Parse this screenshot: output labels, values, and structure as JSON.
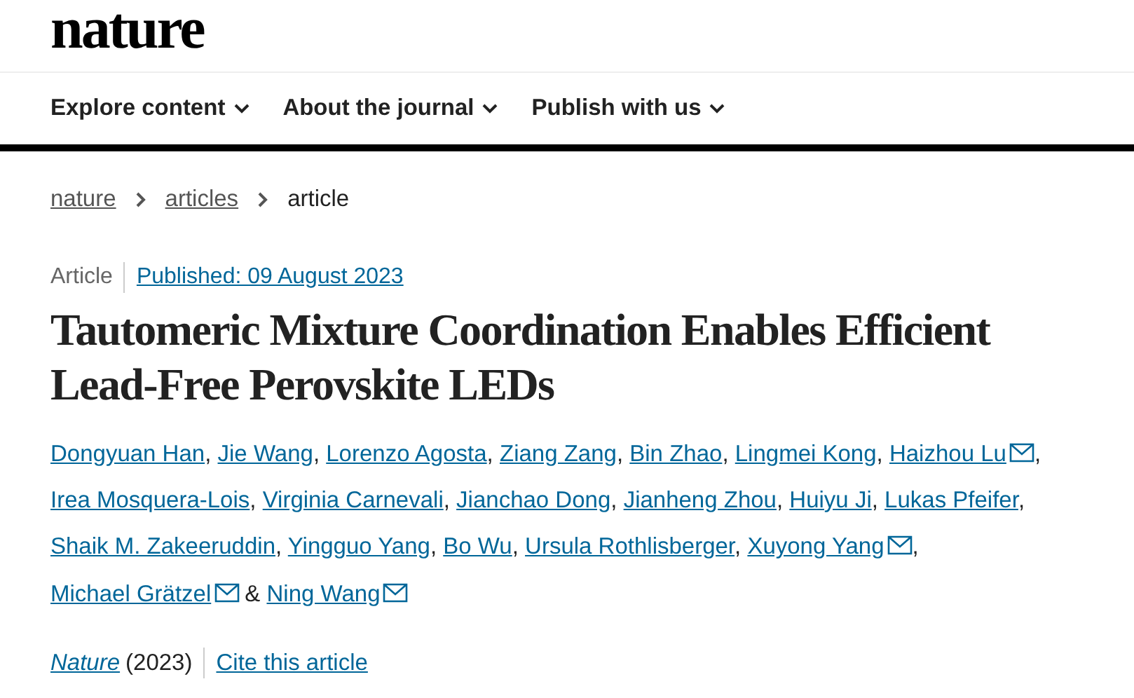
{
  "logo": "nature",
  "nav": [
    {
      "label": "Explore content"
    },
    {
      "label": "About the journal"
    },
    {
      "label": "Publish with us"
    }
  ],
  "breadcrumb": [
    {
      "label": "nature",
      "link": true
    },
    {
      "label": "articles",
      "link": true
    },
    {
      "label": "article",
      "link": false
    }
  ],
  "article_type": "Article",
  "published": "Published: 09 August 2023",
  "title": "Tautomeric Mixture Coordination Enables Efficient Lead-Free Perovskite LEDs",
  "authors": [
    {
      "name": "Dongyuan Han",
      "contact": false,
      "after": ","
    },
    {
      "name": "Jie Wang",
      "contact": false,
      "after": ","
    },
    {
      "name": "Lorenzo Agosta",
      "contact": false,
      "after": ","
    },
    {
      "name": "Ziang Zang",
      "contact": false,
      "after": ","
    },
    {
      "name": "Bin Zhao",
      "contact": false,
      "after": ","
    },
    {
      "name": "Lingmei Kong",
      "contact": false,
      "after": ","
    },
    {
      "name": "Haizhou Lu",
      "contact": true,
      "after": ","
    },
    {
      "name": "Irea Mosquera-Lois",
      "contact": false,
      "after": ","
    },
    {
      "name": "Virginia Carnevali",
      "contact": false,
      "after": ","
    },
    {
      "name": "Jianchao Dong",
      "contact": false,
      "after": ","
    },
    {
      "name": "Jianheng Zhou",
      "contact": false,
      "after": ","
    },
    {
      "name": "Huiyu Ji",
      "contact": false,
      "after": ","
    },
    {
      "name": "Lukas Pfeifer",
      "contact": false,
      "after": ","
    },
    {
      "name": "Shaik M. Zakeeruddin",
      "contact": false,
      "after": ","
    },
    {
      "name": "Yingguo Yang",
      "contact": false,
      "after": ","
    },
    {
      "name": "Bo Wu",
      "contact": false,
      "after": ","
    },
    {
      "name": "Ursula Rothlisberger",
      "contact": false,
      "after": ","
    },
    {
      "name": "Xuyong Yang",
      "contact": true,
      "after": ","
    },
    {
      "name": "Michael Grätzel",
      "contact": true,
      "after": "&"
    },
    {
      "name": "Ning Wang",
      "contact": true
    }
  ],
  "journal": "Nature",
  "year": "(2023)",
  "cite": "Cite this article"
}
